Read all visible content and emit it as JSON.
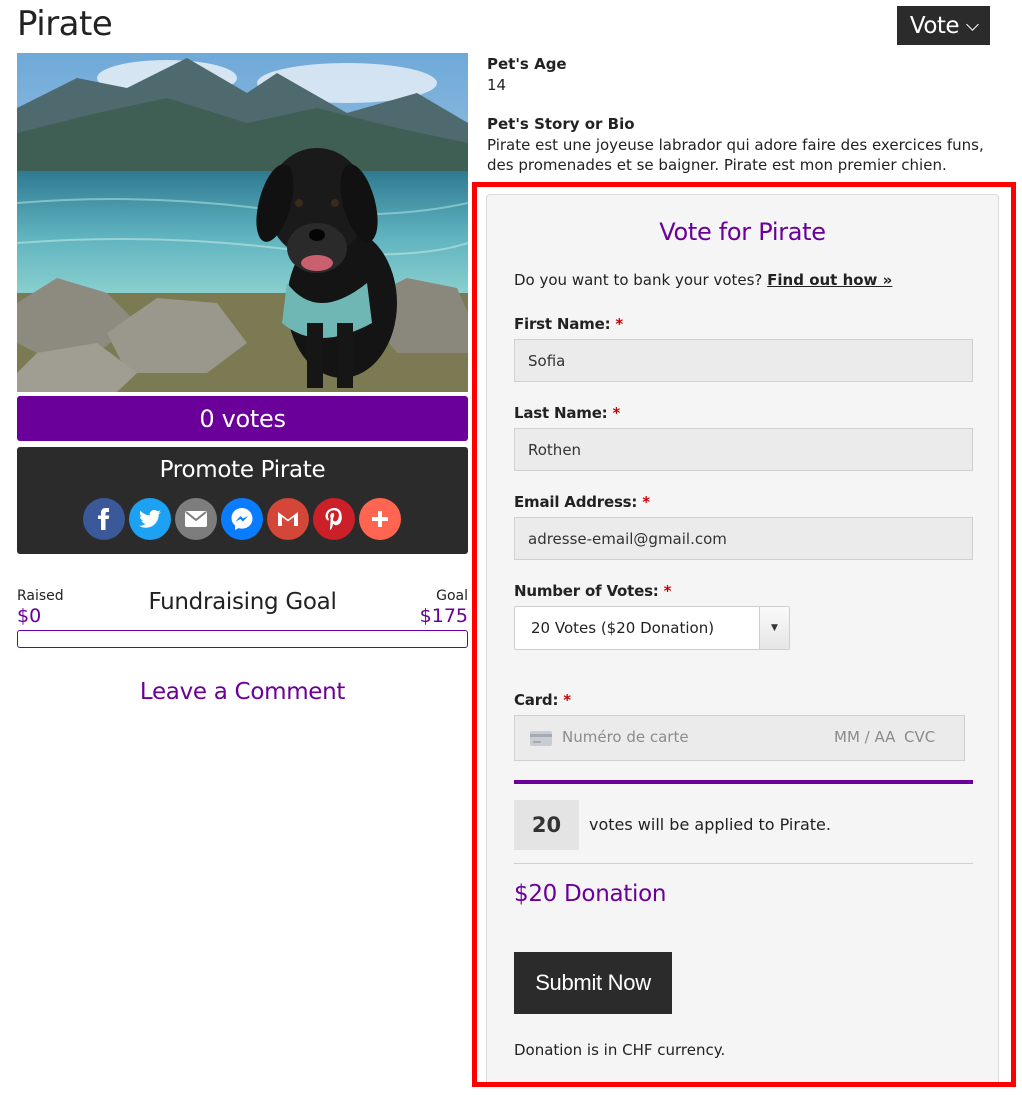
{
  "header": {
    "title": "Pirate",
    "vote_menu_label": "Vote"
  },
  "pet": {
    "votes_label": "0 votes",
    "promote_title": "Promote Pirate",
    "share_icons": [
      "facebook-icon",
      "twitter-icon",
      "email-icon",
      "messenger-icon",
      "gmail-icon",
      "pinterest-icon",
      "more-share-icon"
    ],
    "colors": {
      "purple": "#6a0099",
      "dark": "#2b2b2b",
      "facebook": "#3b5998",
      "twitter": "#1da1f2",
      "email": "#7d7d7d",
      "messenger": "#0a7cff",
      "gmail": "#d44638",
      "pinterest": "#cb2027",
      "more": "#ff6550"
    }
  },
  "fundraising": {
    "raised_label": "Raised",
    "raised_value": "$0",
    "heading": "Fundraising Goal",
    "goal_label": "Goal",
    "goal_value": "$175",
    "progress": 0
  },
  "comments": {
    "heading": "Leave a Comment"
  },
  "details": {
    "age_label": "Pet's Age",
    "age_value": "14",
    "bio_label": "Pet's Story or Bio",
    "bio_text": "Pirate est une joyeuse labrador qui adore faire des exercices funs, des promenades et se baigner. Pirate est mon premier chien."
  },
  "form": {
    "title": "Vote for Pirate",
    "bank_question": "Do you want to bank your votes?",
    "bank_link": "Find out how »",
    "required_mark": "*",
    "first_name_label": "First Name:",
    "first_name_value": "Sofia",
    "last_name_label": "Last Name:",
    "last_name_value": "Rothen",
    "email_label": "Email Address:",
    "email_value": "adresse-email@gmail.com",
    "votes_label": "Number of Votes:",
    "votes_selected": "20 Votes ($20 Donation)",
    "card_label": "Card:",
    "card_placeholder": "Numéro de carte",
    "card_expiry_placeholder": "MM / AA",
    "card_cvc_placeholder": "CVC",
    "vote_count": "20",
    "votes_applied_text": "votes will be applied to Pirate.",
    "donation_amount": "$20 Donation",
    "submit_label": "Submit Now",
    "currency_note": "Donation is in CHF currency."
  }
}
